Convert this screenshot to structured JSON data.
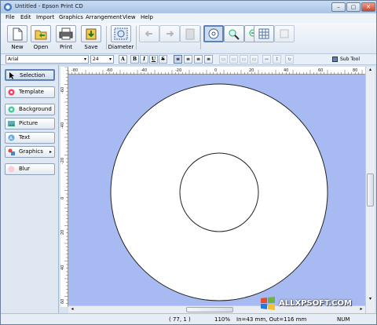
{
  "window": {
    "title": "Untitled - Epson Print CD"
  },
  "window_controls": {
    "minimize": "–",
    "maximize": "▢",
    "close": "✕"
  },
  "menu": [
    "File",
    "Edit",
    "Import",
    "Graphics",
    "Arrangement",
    "View",
    "Help"
  ],
  "toolbar": {
    "buttons": [
      {
        "label": "New",
        "icon": "new-document-icon"
      },
      {
        "label": "Open",
        "icon": "open-folder-icon"
      },
      {
        "label": "Print",
        "icon": "printer-icon"
      },
      {
        "label": "Save",
        "icon": "save-icon"
      },
      {
        "label": "Diameter",
        "icon": "diameter-icon"
      }
    ]
  },
  "format_bar": {
    "font": "Arial",
    "size": "24",
    "bold": "B",
    "italic": "I",
    "underline": "U",
    "strike": "S",
    "sub_tool": "Sub Tool"
  },
  "left_panel": {
    "items": [
      {
        "label": "Selection",
        "icon": "cursor-icon",
        "active": true
      },
      {
        "label": "Template",
        "icon": "template-icon"
      },
      {
        "label": "Background",
        "icon": "background-icon"
      },
      {
        "label": "Picture",
        "icon": "picture-icon"
      },
      {
        "label": "Text",
        "icon": "text-icon"
      },
      {
        "label": "Graphics",
        "icon": "graphics-icon",
        "submenu": "▸"
      },
      {
        "label": "Blur",
        "icon": "blur-icon"
      }
    ]
  },
  "ruler": {
    "h_labels": [
      "-80",
      "-60",
      "-40",
      "-20",
      "0",
      "20",
      "40",
      "60",
      "80"
    ],
    "v_labels": [
      "-60",
      "-40",
      "-20",
      "0",
      "20",
      "40",
      "60"
    ]
  },
  "status": {
    "coords": "( 77, 1 )",
    "zoom": "110%",
    "info": "In=43 mm, Out=116 mm",
    "num": "NUM"
  },
  "watermark": "ALLXPSOFT.COM",
  "colors": {
    "canvas_bg": "#a7bbf2",
    "disc": "#ffffff",
    "accent": "#5d82b8"
  }
}
